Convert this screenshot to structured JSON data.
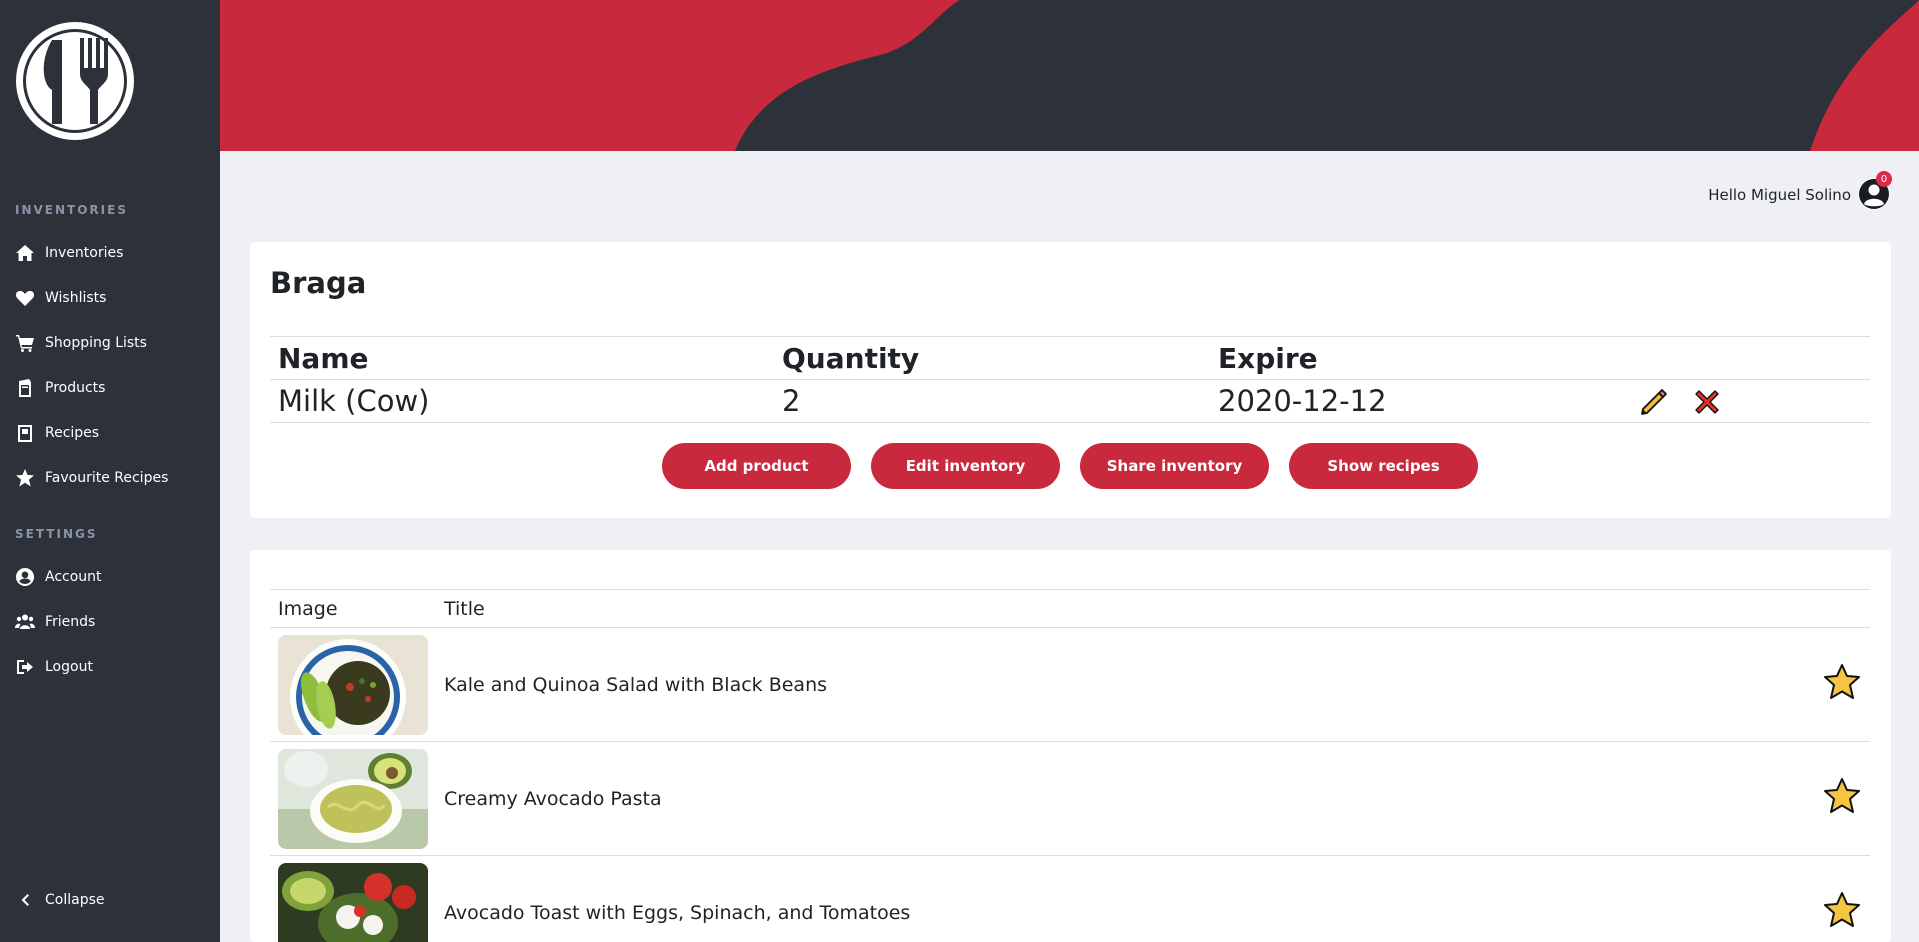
{
  "sidebar": {
    "sections": [
      {
        "title": "INVENTORIES",
        "items": [
          {
            "label": "Inventories",
            "icon": "home-icon"
          },
          {
            "label": "Wishlists",
            "icon": "heart-icon"
          },
          {
            "label": "Shopping Lists",
            "icon": "cart-icon"
          },
          {
            "label": "Products",
            "icon": "product-box-icon"
          },
          {
            "label": "Recipes",
            "icon": "recipe-book-icon"
          },
          {
            "label": "Favourite Recipes",
            "icon": "star-icon"
          }
        ]
      },
      {
        "title": "SETTINGS",
        "items": [
          {
            "label": "Account",
            "icon": "user-circle-icon"
          },
          {
            "label": "Friends",
            "icon": "users-icon"
          },
          {
            "label": "Logout",
            "icon": "sign-out-icon"
          }
        ]
      }
    ],
    "collapse_label": "Collapse"
  },
  "header": {
    "greeting": "Hello Miguel Solino",
    "notification_count": "0"
  },
  "inventory": {
    "title": "Braga",
    "columns": [
      "Name",
      "Quantity",
      "Expire"
    ],
    "rows": [
      {
        "name": "Milk (Cow)",
        "quantity": "2",
        "expire": "2020-12-12"
      }
    ],
    "buttons": {
      "add": "Add product",
      "edit": "Edit inventory",
      "share": "Share inventory",
      "recipes": "Show recipes"
    }
  },
  "recipes": {
    "columns": [
      "Image",
      "Title"
    ],
    "rows": [
      {
        "title": "Kale and Quinoa Salad with Black Beans"
      },
      {
        "title": "Creamy Avocado Pasta"
      },
      {
        "title": "Avocado Toast with Eggs, Spinach, and Tomatoes"
      }
    ]
  },
  "colors": {
    "accent": "#c8293d",
    "sidebar": "#2c313a",
    "background": "#eef0f5",
    "star": "#f5c542"
  }
}
